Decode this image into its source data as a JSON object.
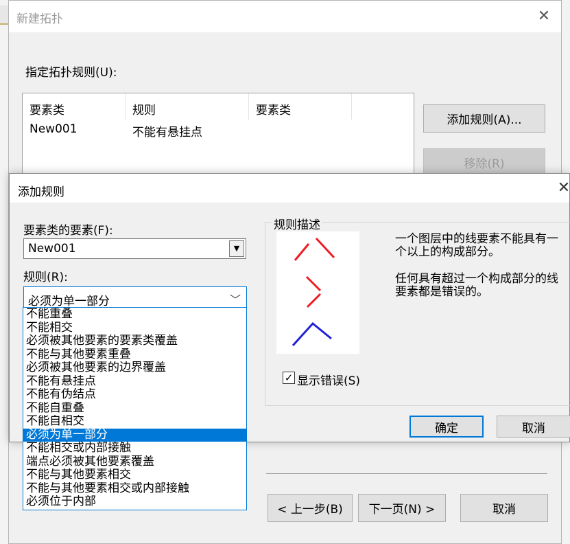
{
  "outer_dialog": {
    "title": "新建拓扑",
    "close_glyph": "✕",
    "specify_rules_label": "指定拓扑规则(U):",
    "columns": [
      "要素类",
      "规则",
      "要素类"
    ],
    "rows": [
      {
        "feature_class": "New001",
        "rule": "不能有悬挂点",
        "feature_class_2": ""
      }
    ],
    "add_rule_button": "添加规则(A)...",
    "remove_button": "移除(R)",
    "back_button": "< 上一步(B)",
    "next_button": "下一页(N) >",
    "cancel_button": "取消"
  },
  "add_rule_dialog": {
    "title": "添加规则",
    "close_glyph": "✕",
    "feature_label": "要素类的要素(F):",
    "feature_value": "New001",
    "rule_label": "规则(R):",
    "rule_value": "必须为单一部分",
    "description_group_title": "规则描述",
    "description_1": "一个图层中的线要素不能具有一个以上的构成部分。",
    "description_2": "任何具有超过一个构成部分的线要素都是错误的。",
    "show_errors_checked": true,
    "show_errors_label": "显示错误(S)",
    "ok_button": "确定",
    "cancel_button": "取消",
    "rule_options": [
      "不能重叠",
      "不能相交",
      "必须被其他要素的要素类覆盖",
      "不能与其他要素重叠",
      "必须被其他要素的边界覆盖",
      "不能有悬挂点",
      "不能有伪结点",
      "不能自重叠",
      "不能自相交",
      "必须为单一部分",
      "不能相交或内部接触",
      "端点必须被其他要素覆盖",
      "不能与其他要素相交",
      "不能与其他要素相交或内部接触",
      "必须位于内部"
    ],
    "selected_rule_index": 9,
    "colors": {
      "error_lines": "#ee1c24",
      "valid_lines": "#1f1fd6",
      "selection": "#0078d7"
    }
  }
}
